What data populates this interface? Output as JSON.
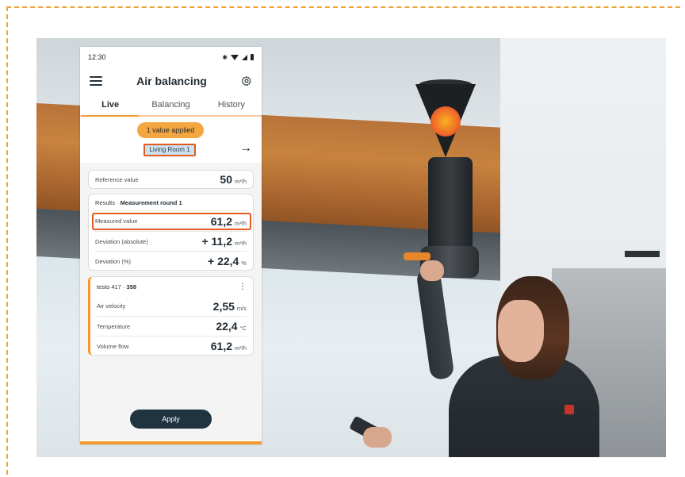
{
  "status_bar": {
    "time": "12:30",
    "bluetooth_glyph": "✱"
  },
  "app_bar": {
    "title": "Air balancing"
  },
  "tabs": [
    {
      "label": "Live",
      "active": true
    },
    {
      "label": "Balancing",
      "active": false
    },
    {
      "label": "History",
      "active": false
    }
  ],
  "banner": {
    "applied_label": "1 value applied"
  },
  "room": {
    "name": "Living Room 1"
  },
  "reference": {
    "label": "Reference value",
    "value": "50",
    "unit": "m³/h"
  },
  "results": {
    "header_prefix": "Results · ",
    "header_strong": "Measurement round 1",
    "rows": [
      {
        "label": "Measured value",
        "value": "61,2",
        "unit": "m³/h"
      },
      {
        "label": "Deviation (absolute)",
        "value": "+ 11,2",
        "unit": "m³/h"
      },
      {
        "label": "Deviation (%)",
        "value": "+ 22,4",
        "unit": "%"
      }
    ]
  },
  "sensor": {
    "header_prefix": "testo 417 · ",
    "header_strong": "358",
    "more_glyph": "⋮",
    "rows": [
      {
        "label": "Air velocity",
        "value": "2,55",
        "unit": "m/s"
      },
      {
        "label": "Temperature",
        "value": "22,4",
        "unit": "°C"
      },
      {
        "label": "Volume flow",
        "value": "61,2",
        "unit": "m³/h"
      }
    ]
  },
  "actions": {
    "apply_label": "Apply"
  },
  "arrow_glyph": "→",
  "colors": {
    "accent_orange": "#f29a2e",
    "highlight_red": "#e15b21",
    "button_dark": "#1f3440",
    "chip_blue": "#cbe1f1"
  }
}
